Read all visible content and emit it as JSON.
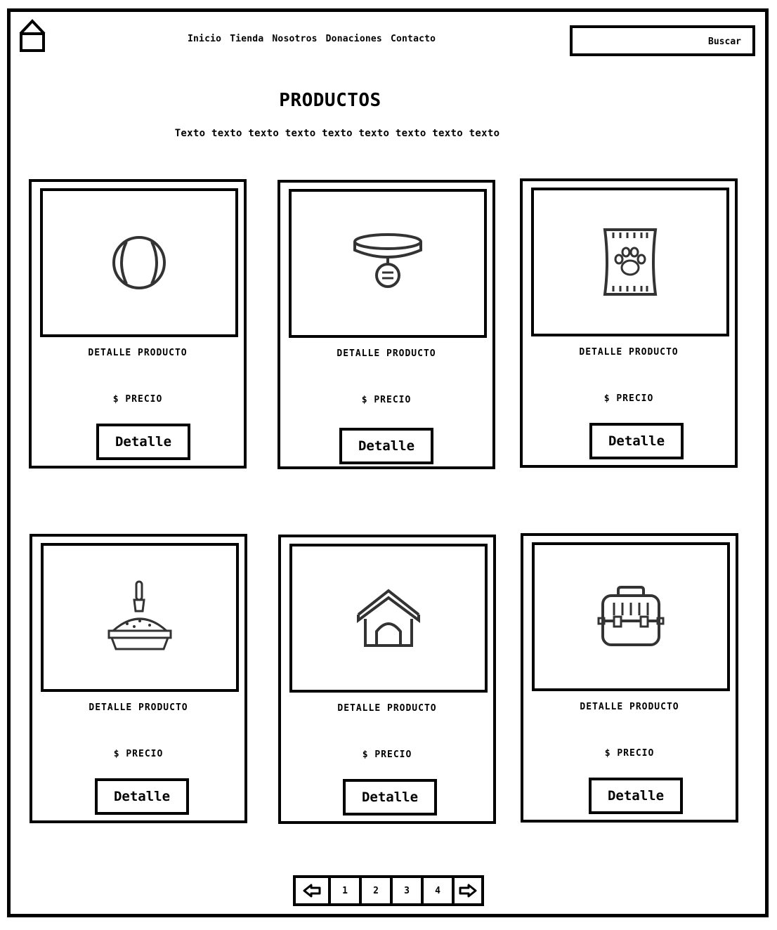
{
  "header": {
    "nav": [
      "Inicio",
      "Tienda",
      "Nosotros",
      "Donaciones",
      "Contacto"
    ],
    "search": {
      "button_label": "Buscar",
      "placeholder": "",
      "value": ""
    }
  },
  "main": {
    "title": "PRODUCTOS",
    "subtitle": "Texto texto texto texto texto texto texto texto texto"
  },
  "products": [
    {
      "icon": "ball-icon",
      "detail": "DETALLE PRODUCTO",
      "price": "$ PRECIO",
      "button": "Detalle"
    },
    {
      "icon": "collar-icon",
      "detail": "DETALLE PRODUCTO",
      "price": "$ PRECIO",
      "button": "Detalle"
    },
    {
      "icon": "pet-food-bag-icon",
      "detail": "DETALLE PRODUCTO",
      "price": "$ PRECIO",
      "button": "Detalle"
    },
    {
      "icon": "litter-box-scoop-icon",
      "detail": "DETALLE PRODUCTO",
      "price": "$ PRECIO",
      "button": "Detalle"
    },
    {
      "icon": "dog-house-icon",
      "detail": "DETALLE PRODUCTO",
      "price": "$ PRECIO",
      "button": "Detalle"
    },
    {
      "icon": "pet-carrier-icon",
      "detail": "DETALLE PRODUCTO",
      "price": "$ PRECIO",
      "button": "Detalle"
    }
  ],
  "pagination": {
    "prev_icon": "arrow-left-icon",
    "pages": [
      "1",
      "2",
      "3",
      "4"
    ],
    "next_icon": "arrow-right-icon"
  }
}
